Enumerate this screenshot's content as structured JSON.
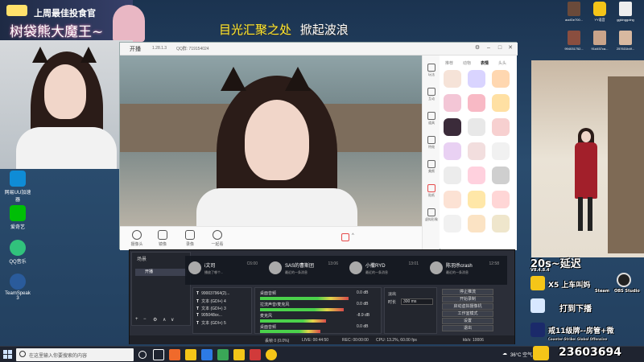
{
  "stream_overlay": {
    "banner_title": "上周最佳投食官",
    "banner_name": "树袋熊大魔王~",
    "headline_a": "目光汇聚之处",
    "headline_b": "掀起波浪"
  },
  "desktop_icons": [
    {
      "label": "网易UU加速器",
      "color": "#0f8cd6"
    },
    {
      "label": "爱奇艺",
      "color": "#00be06"
    },
    {
      "label": "QQ音乐",
      "color": "#31c27c"
    },
    {
      "label": "TeamSpeak 3",
      "color": "#2a5b9b"
    }
  ],
  "broadcaster": {
    "title": "开播",
    "version": "1.28.1.3",
    "qq_group": "QQ群: 719154024",
    "tools": [
      "摄像头",
      "镜像",
      "录像",
      "一起看"
    ],
    "side_items": [
      "玩法",
      "互动",
      "道具",
      "特效",
      "美颜",
      "贴纸",
      "虚拟形象"
    ],
    "sticker_tabs": [
      "推荐",
      "动物",
      "表情",
      "头头"
    ],
    "sticker_active": "表情"
  },
  "studio": {
    "scenes_title": "场景",
    "scene_item": "开播",
    "sources": [
      {
        "icon": "T",
        "label": "990037964(2)..."
      },
      {
        "icon": "T",
        "label": "文本 (GDI+) 4"
      },
      {
        "icon": "T",
        "label": "文本 (GDI+) 3"
      },
      {
        "icon": "T",
        "label": "905048xx..."
      },
      {
        "icon": "T",
        "label": "文本 (GDI+) 5"
      }
    ],
    "mixer": [
      {
        "label": "桌面音频",
        "db": "0.0 dB",
        "fill": 0.75
      },
      {
        "label": "拉流声音/麦克风",
        "db": "0.0 dB",
        "fill": 0.7
      },
      {
        "label": "麦克风",
        "db": "-8.9 dB",
        "fill": 0.55
      },
      {
        "label": "桌面音频",
        "db": "0.0 dB",
        "fill": 0.5
      }
    ],
    "transition_label": "淡出",
    "duration_label": "时长",
    "duration_value": "300 ms",
    "controls": [
      "停止推流",
      "开始录制",
      "启动虚拟摄像机",
      "工作室模式",
      "设置",
      "退出"
    ],
    "status": {
      "dropped": "丢帧 0 (0.0%)",
      "live": "LIVE: 00:44:50",
      "rec": "REC: 00:00:00",
      "cpu": "CPU: 13.2%, 60.00 fps",
      "kbps": "kb/s: 10006"
    }
  },
  "chat": [
    {
      "name": "i文司",
      "sub": "播放了哪个...",
      "time": "C6:00"
    },
    {
      "name": "SAS的曹斯团",
      "sub": "最近的一条消息",
      "time": "13:06"
    },
    {
      "name": "小撒RYD",
      "sub": "最近的一条消息",
      "time": "13:01"
    },
    {
      "name": "陈羽杀crash",
      "sub": "最近的一条消息",
      "time": "12:58"
    }
  ],
  "right_top_icons": [
    {
      "label": "aodGe700...",
      "color": "#6a4a3a"
    },
    {
      "label": "YY语音",
      "color": "#f5c518"
    },
    {
      "label": "ggkinggoing",
      "color": "#eeeeee"
    },
    {
      "label": "994031752...",
      "color": "#8a4e3f"
    },
    {
      "label": "91d457ca...",
      "color": "#c9a48a"
    },
    {
      "label": "257631b4f...",
      "color": "#d8b9a0"
    }
  ],
  "right_overlay": {
    "delay": "20s~延迟",
    "version": "V8.4.8.4",
    "steam": "Steam",
    "obs": "OBS Studio",
    "line1": "X5  上车叫妈",
    "line2": "打到下播",
    "line3": "戒11级牌--房管+微",
    "counter": "23603694",
    "small_label": "Counter-Strike: Global Offensive"
  },
  "taskbar": {
    "search_placeholder": "在这里输入你要搜索的内容",
    "weather": "36°C 空气...",
    "apps": [
      "#e8e8e8",
      "#f06a2b",
      "#f5c518",
      "#2d7be5",
      "#3aa757",
      "#f5c518",
      "#d13a3a",
      "#f5c518",
      "#e8e8e8",
      "#f5c518"
    ]
  }
}
